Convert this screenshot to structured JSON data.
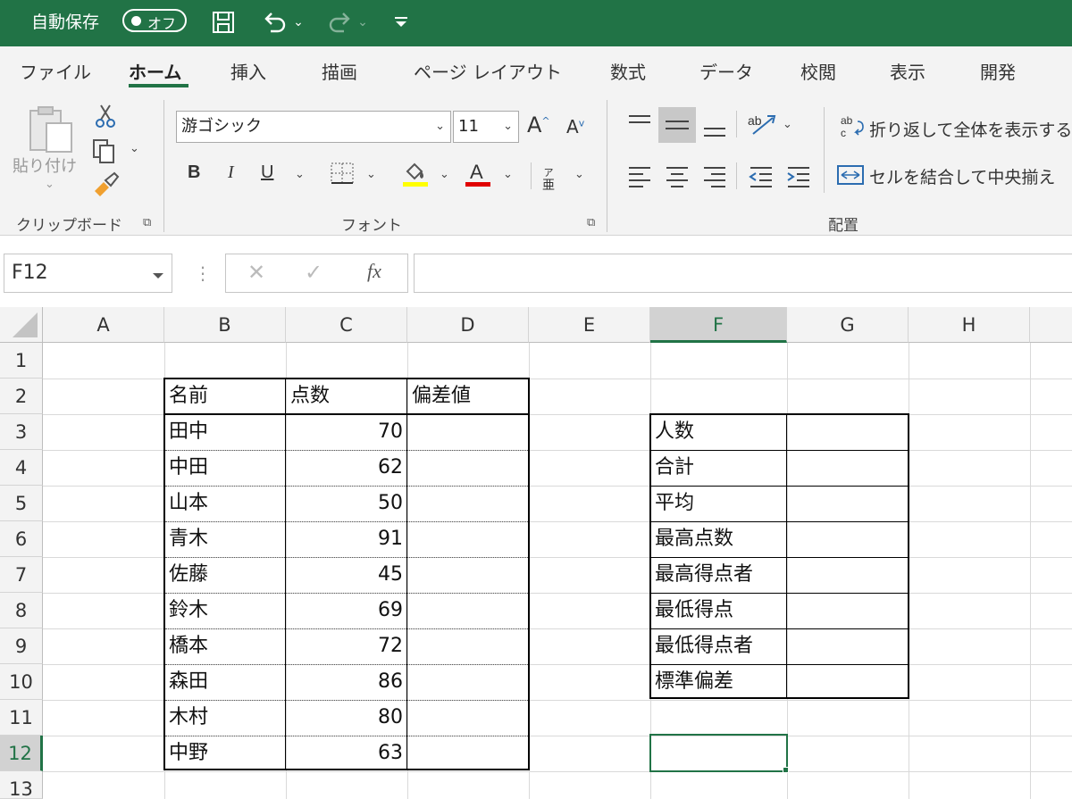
{
  "titlebar": {
    "autosave_label": "自動保存",
    "autosave_state": "オフ"
  },
  "tabs": [
    "ファイル",
    "ホーム",
    "挿入",
    "描画",
    "ページ レイアウト",
    "数式",
    "データ",
    "校閲",
    "表示",
    "開発"
  ],
  "ribbon": {
    "paste_label": "貼り付け",
    "clipboard_group": "クリップボード",
    "font_name": "游ゴシック",
    "font_size": "11",
    "bold": "B",
    "italic": "I",
    "underline": "U",
    "font_group": "フォント",
    "phonetic_label": "亜",
    "wrap_text": "折り返して全体を表示する",
    "merge_center": "セルを結合して中央揃え",
    "alignment_group": "配置",
    "colors": {
      "highlight": "#ffff00",
      "font_color": "#e00000",
      "accent": "#217346"
    }
  },
  "namebox": "F12",
  "formula": "",
  "columns": [
    "A",
    "B",
    "C",
    "D",
    "E",
    "F",
    "G",
    "H"
  ],
  "rows": [
    "1",
    "2",
    "3",
    "4",
    "5",
    "6",
    "7",
    "8",
    "9",
    "10",
    "11",
    "12",
    "13"
  ],
  "selected_cell": "F12",
  "score_table": {
    "headers": [
      "名前",
      "点数",
      "偏差値"
    ],
    "rows": [
      {
        "name": "田中",
        "score": "70",
        "dev": ""
      },
      {
        "name": "中田",
        "score": "62",
        "dev": ""
      },
      {
        "name": "山本",
        "score": "50",
        "dev": ""
      },
      {
        "name": "青木",
        "score": "91",
        "dev": ""
      },
      {
        "name": "佐藤",
        "score": "45",
        "dev": ""
      },
      {
        "name": "鈴木",
        "score": "69",
        "dev": ""
      },
      {
        "name": "橋本",
        "score": "72",
        "dev": ""
      },
      {
        "name": "森田",
        "score": "86",
        "dev": ""
      },
      {
        "name": "木村",
        "score": "80",
        "dev": ""
      },
      {
        "name": "中野",
        "score": "63",
        "dev": ""
      }
    ]
  },
  "stats_table": {
    "rows": [
      {
        "label": "人数",
        "value": ""
      },
      {
        "label": "合計",
        "value": ""
      },
      {
        "label": "平均",
        "value": ""
      },
      {
        "label": "最高点数",
        "value": ""
      },
      {
        "label": "最高得点者",
        "value": ""
      },
      {
        "label": "最低得点",
        "value": ""
      },
      {
        "label": "最低得点者",
        "value": ""
      },
      {
        "label": "標準偏差",
        "value": ""
      }
    ]
  }
}
